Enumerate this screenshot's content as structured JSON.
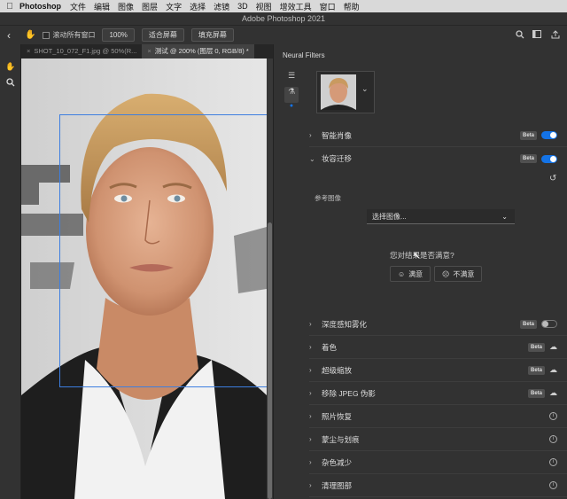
{
  "menubar": {
    "app": "Photoshop",
    "items": [
      "文件",
      "编辑",
      "图像",
      "图层",
      "文字",
      "选择",
      "滤镜",
      "3D",
      "视图",
      "增效工具",
      "窗口",
      "帮助"
    ]
  },
  "window": {
    "title": "Adobe Photoshop 2021"
  },
  "options": {
    "scroll_all_label": "滚动所有窗口",
    "zoom_label": "100%",
    "fit_label": "适合屏幕",
    "fill_label": "填充屏幕"
  },
  "tabs": [
    {
      "label": "SHOT_10_072_F1.jpg @ 50%(R...",
      "active": false
    },
    {
      "label": "测试 @ 200% (图层 0, RGB/8) *",
      "active": true
    }
  ],
  "panel": {
    "title": "Neural Filters",
    "filters": [
      {
        "label": "智能肖像",
        "expanded": false,
        "badge": "Beta",
        "control": "toggle-on"
      },
      {
        "label": "妆容迁移",
        "expanded": true,
        "badge": "Beta",
        "control": "toggle-on"
      },
      {
        "label": "深度感知雾化",
        "expanded": false,
        "badge": "Beta",
        "control": "toggle-off"
      },
      {
        "label": "着色",
        "expanded": false,
        "badge": "Beta",
        "control": "cloud"
      },
      {
        "label": "超级缩放",
        "expanded": false,
        "badge": "Beta",
        "control": "cloud"
      },
      {
        "label": "移除 JPEG 伪影",
        "expanded": false,
        "badge": "Beta",
        "control": "cloud"
      },
      {
        "label": "照片恢复",
        "expanded": false,
        "badge": "",
        "control": "info"
      },
      {
        "label": "蒙尘与划痕",
        "expanded": false,
        "badge": "",
        "control": "info"
      },
      {
        "label": "杂色减少",
        "expanded": false,
        "badge": "",
        "control": "info"
      },
      {
        "label": "清理图部",
        "expanded": false,
        "badge": "",
        "control": "info"
      }
    ],
    "makeup": {
      "reference_label": "参考图像",
      "select_placeholder": "选择图像...",
      "question": "您对结果是否满意?",
      "satisfied": "满意",
      "unsatisfied": "不满意"
    }
  },
  "colors": {
    "accent": "#1473e6",
    "panel_bg": "#323232",
    "selection": "#3d7ee0"
  }
}
